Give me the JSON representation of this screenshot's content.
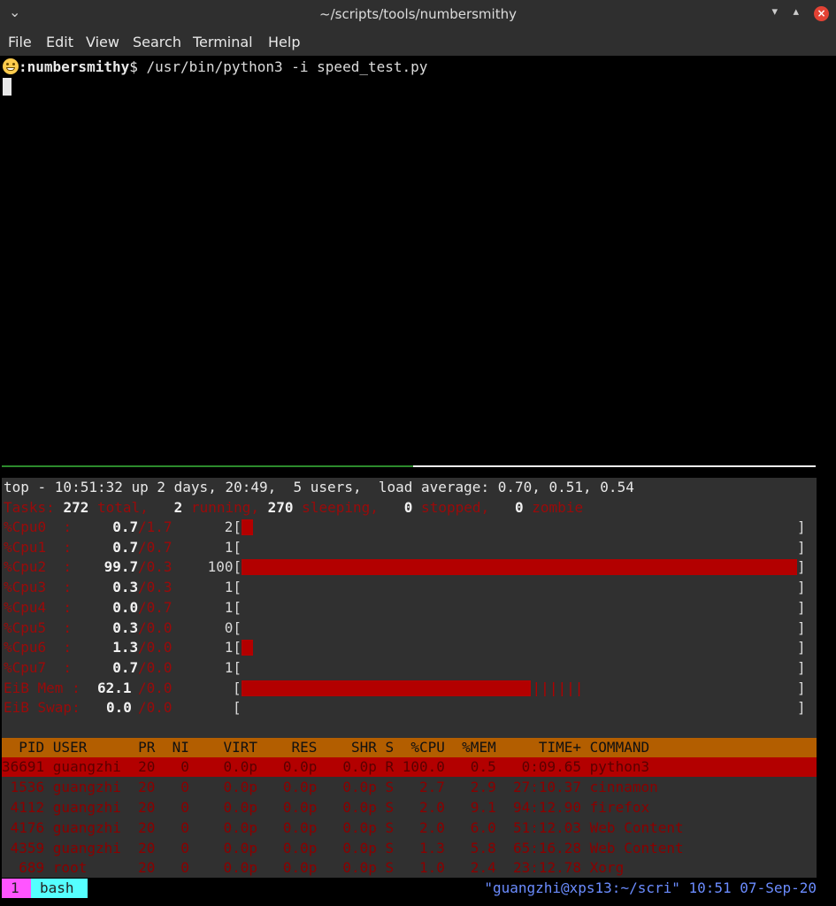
{
  "window": {
    "title": "~/scripts/tools/numbersmithy"
  },
  "menu": [
    "File",
    "Edit",
    "View",
    "Search",
    "Terminal",
    "Help"
  ],
  "prompt": {
    "icon": "grinning-face-emoji",
    "host": ":numbersmithy",
    "sign": "$",
    "command": " /usr/bin/python3 -i speed_test.py"
  },
  "top": {
    "summary": "top - 10:51:32 up 2 days, 20:49,  5 users,  load average: 0.70, 0.51, 0.54",
    "tasks": {
      "label": "Tasks: ",
      "total": "272",
      "total_lbl": " total,   ",
      "running": "2",
      "running_lbl": " running, ",
      "sleeping": "270",
      "sleeping_lbl": " sleeping,   ",
      "stopped": "0",
      "stopped_lbl": " stopped,   ",
      "zombie": "0",
      "zombie_lbl": " zombie"
    },
    "cpus": [
      {
        "label": "%Cpu0  :",
        "us": "0.7",
        "sy": "/1.7",
        "pct": "2[",
        "close": "]",
        "fill": 0.02
      },
      {
        "label": "%Cpu1  :",
        "us": "0.7",
        "sy": "/0.7",
        "pct": "1[",
        "close": "]",
        "fill": 0.0
      },
      {
        "label": "%Cpu2  :",
        "us": "99.7",
        "sy": "/0.3",
        "pct": "100[",
        "close": "]",
        "fill": 1.0
      },
      {
        "label": "%Cpu3  :",
        "us": "0.3",
        "sy": "/0.3",
        "pct": "1[",
        "close": "]",
        "fill": 0.0
      },
      {
        "label": "%Cpu4  :",
        "us": "0.0",
        "sy": "/0.7",
        "pct": "1[",
        "close": "]",
        "fill": 0.0
      },
      {
        "label": "%Cpu5  :",
        "us": "0.3",
        "sy": "/0.0",
        "pct": "0[",
        "close": "]",
        "fill": 0.0
      },
      {
        "label": "%Cpu6  :",
        "us": "1.3",
        "sy": "/0.0",
        "pct": "1[",
        "close": "]",
        "fill": 0.02
      },
      {
        "label": "%Cpu7  :",
        "us": "0.7",
        "sy": "/0.0",
        "pct": "1[",
        "close": "]",
        "fill": 0.0
      }
    ],
    "mem": {
      "label": "EiB Mem :",
      "used": "62.1",
      "rest": "/0.0",
      "open": "[",
      "close": "]",
      "fill": 0.52,
      "buffer_ticks": "||||||"
    },
    "swap": {
      "label": "EiB Swap:",
      "used": "0.0",
      "rest": "/0.0",
      "open": "[",
      "close": "]"
    },
    "header": "  PID USER      PR  NI    VIRT    RES    SHR S  %CPU  %MEM     TIME+ COMMAND",
    "processes": [
      "36691 guangzhi  20   0    0.0p   0.0p   0.0p R 100.0   0.5   0:09.65 python3",
      " 1536 guangzhi  20   0    0.0p   0.0p   0.0p S   2.7   2.9  27:10.37 cinnamon",
      " 4112 guangzhi  20   0    0.0p   0.0p   0.0p S   2.0   9.1  94:12.90 firefox",
      " 4176 guangzhi  20   0    0.0p   0.0p   0.0p S   2.0   6.0  51:12.03 Web Content",
      " 4359 guangzhi  20   0    0.0p   0.0p   0.0p S   1.3   5.8  65:16.28 Web Content",
      "  689 root      20   0    0.0p   0.0p   0.0p S   1.0   2.4  23:12.78 Xorg"
    ]
  },
  "tmux": {
    "window_index": "1",
    "window_name": "bash",
    "right": "\"guangzhi@xps13:~/scri\" 10:51 07-Sep-20"
  },
  "colors": {
    "bar": "#b30000",
    "header": "#b35e00",
    "dim_red": "#8b0000",
    "status_blue": "#6b8cff"
  }
}
